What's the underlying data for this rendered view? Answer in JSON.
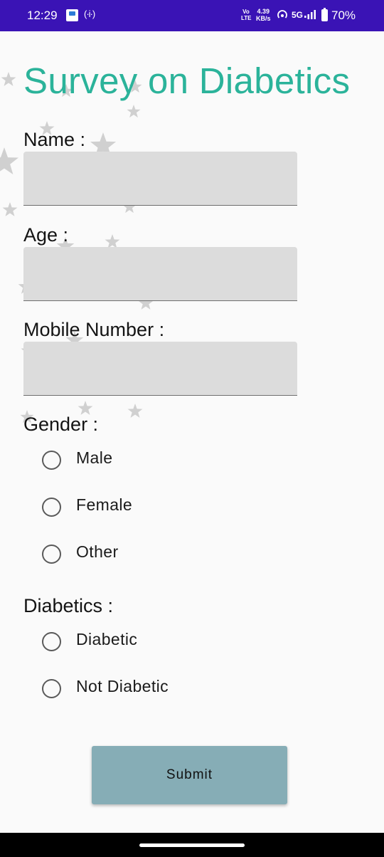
{
  "status_bar": {
    "time": "12:29",
    "network_type": "VoLTE",
    "volte_label": "Vo LTE",
    "speed_value": "4.39",
    "speed_unit": "KB/s",
    "network": "5G",
    "battery": "70%"
  },
  "form": {
    "title": "Survey on Diabetics",
    "name_label": "Name :",
    "name_value": "",
    "age_label": "Age :",
    "age_value": "",
    "mobile_label": "Mobile Number :",
    "mobile_value": "",
    "gender_label": "Gender :",
    "gender_options": [
      "Male",
      "Female",
      "Other"
    ],
    "diabetics_label": "Diabetics :",
    "diabetics_options": [
      "Diabetic",
      "Not Diabetic"
    ],
    "submit_label": "Submit"
  },
  "colors": {
    "status_bar": "#3a13b5",
    "title": "#2bb39a",
    "submit_button": "#86adb6",
    "field_background": "#dcdcdc"
  }
}
